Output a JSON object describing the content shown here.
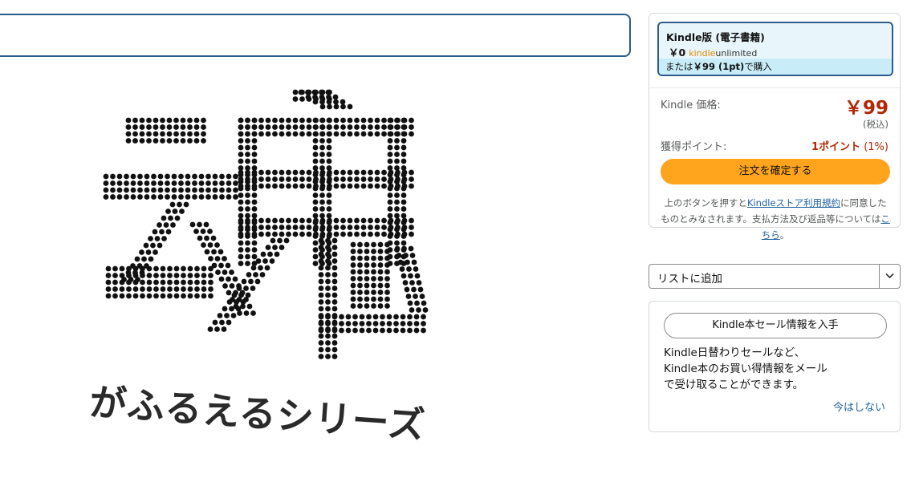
{
  "cover": {
    "title_glyph": "魂",
    "tagline": "がふるえるシリーズ"
  },
  "buybox": {
    "format": {
      "title": "Kindle版 (電子書籍)",
      "price": "￥0",
      "ku_kindle": "kindle",
      "ku_unlimited": "unlimited",
      "alt_prefix": "または",
      "alt_price": "￥99 (1pt)",
      "alt_suffix": "で購入"
    },
    "price_label": "Kindle 価格:",
    "price": "￥99",
    "tax_note": "(税込)",
    "points_label": "獲得ポイント:",
    "points_value": "1ポイント",
    "points_rate": "(1%)",
    "buy_button": "注文を確定する",
    "terms": {
      "part1": "上のボタンを押すと",
      "link1": "Kindleストア利用規約",
      "part2": "に同意したものとみなされます。支払方法及び返品等については",
      "link2": "こちら",
      "part3": "。"
    }
  },
  "add_to_list": {
    "label": "リストに追加"
  },
  "sale_info": {
    "button": "Kindle本セール情報を入手",
    "line1": "Kindle日替わりセールなど、",
    "line2": "Kindle本のお買い得情報をメール",
    "line3": "で受け取ることができます。",
    "not_now": "今はしない"
  },
  "colors": {
    "price_red": "#b12704",
    "buy_orange": "#ffa41c",
    "link_blue": "#2162a1",
    "selected_border": "#2b5c8a",
    "selected_bg": "#e8f6fc"
  },
  "icons": {
    "dropdown": "chevron-down-icon"
  }
}
